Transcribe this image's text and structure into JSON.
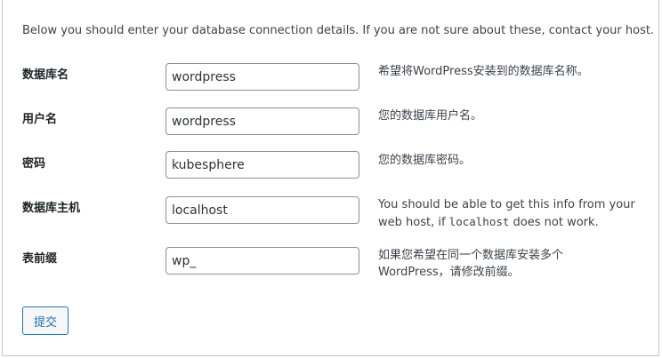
{
  "intro": "Below you should enter your database connection details. If you are not sure about these, contact your host.",
  "rows": [
    {
      "label": "数据库名",
      "value": "wordpress",
      "description": "希望将WordPress安装到的数据库名称。"
    },
    {
      "label": "用户名",
      "value": "wordpress",
      "description": "您的数据库用户名。"
    },
    {
      "label": "密码",
      "value": "kubesphere",
      "description": "您的数据库密码。"
    },
    {
      "label": "数据库主机",
      "value": "localhost",
      "description_before": "You should be able to get this info from your web host, if ",
      "description_code": "localhost",
      "description_after": " does not work."
    },
    {
      "label": "表前缀",
      "value": "wp_",
      "description": "如果您希望在同一个数据库安装多个WordPress，请修改前缀。"
    }
  ],
  "submit_label": "提交"
}
